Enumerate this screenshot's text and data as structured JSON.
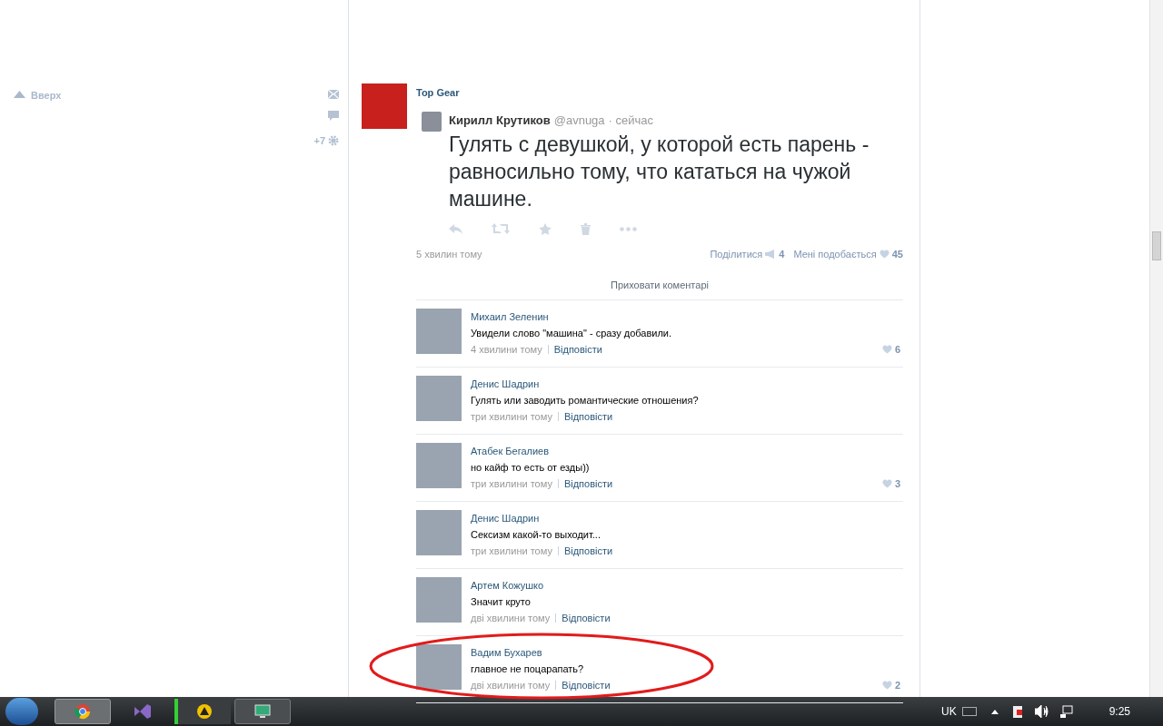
{
  "sidebar": {
    "up_link": "Вверх",
    "counter": "+7"
  },
  "post": {
    "author": "Top Gear",
    "tweet": {
      "name": "Кирилл Крутиков",
      "handle": "@avnuga",
      "time": "· сейчас",
      "text": "Гулять с девушкой, у которой есть парень - равносильно тому, что кататься на чужой машине."
    },
    "time": "5 хвилин тому",
    "share": "Поділитися",
    "share_count": "4",
    "like": "Мені подобається",
    "like_count": "45",
    "hide_comments": "Приховати коментарі"
  },
  "comments": [
    {
      "author": "Михаил Зеленин",
      "text": "Увидели слово \"машина\" - сразу добавили.",
      "time": "4 хвилини тому",
      "reply": "Відповісти",
      "likes": "6",
      "highlighted": false
    },
    {
      "author": "Денис Шадрин",
      "text": "Гулять или заводить романтические отношения?",
      "time": "три хвилини тому",
      "reply": "Відповісти",
      "highlighted": false
    },
    {
      "author": "Атабек Бегалиев",
      "text": "но кайф то есть от езды))",
      "time": "три хвилини тому",
      "reply": "Відповісти",
      "likes": "3",
      "highlighted": false
    },
    {
      "author": "Денис Шадрин",
      "text": "Сексизм какой-то выходит...",
      "time": "три хвилини тому",
      "reply": "Відповісти",
      "highlighted": false
    },
    {
      "author": "Артем Кожушко",
      "text": "Значит круто",
      "time": "дві хвилини тому",
      "reply": "Відповісти",
      "highlighted": false
    },
    {
      "author": "Вадим Бухарев",
      "text": "главное не поцарапать?",
      "time": "дві хвилини тому",
      "reply": "Відповісти",
      "likes": "2",
      "highlighted": true
    }
  ],
  "taskbar": {
    "language": "UK",
    "clock": "9:25"
  }
}
